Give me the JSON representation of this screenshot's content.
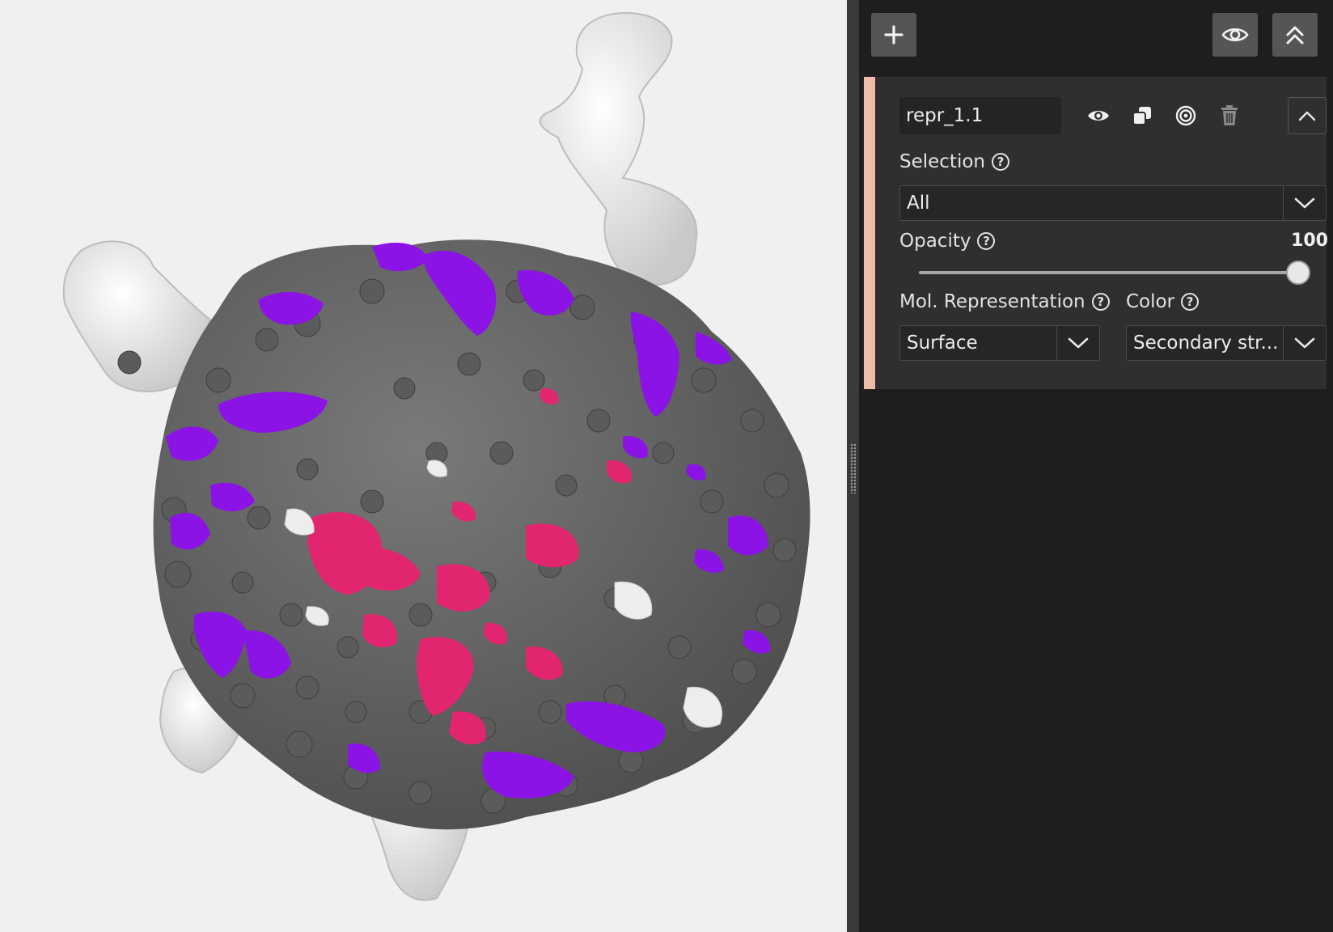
{
  "toolbar": {
    "add_icon": "plus-icon",
    "visibility_icon": "eye-icon",
    "collapse_all_icon": "double-chevron-up-icon"
  },
  "representation": {
    "name": "repr_1.1",
    "actions": [
      "eye-icon",
      "duplicate-icon",
      "target-icon",
      "trash-icon"
    ],
    "collapse_icon": "chevron-up-icon",
    "accent_color": "#f0bcaa",
    "selection": {
      "label": "Selection",
      "value": "All"
    },
    "opacity": {
      "label": "Opacity",
      "value": "100",
      "level": 1.0
    },
    "mol_representation": {
      "label": "Mol. Representation",
      "value": "Surface"
    },
    "color": {
      "label": "Color",
      "value": "Secondary str..."
    }
  },
  "viewer": {
    "colors": {
      "coil": "#636363",
      "helix": "#8b13e6",
      "sheet": "#e2256f",
      "turn": "#ececec",
      "background": "#f0f0f0"
    }
  }
}
